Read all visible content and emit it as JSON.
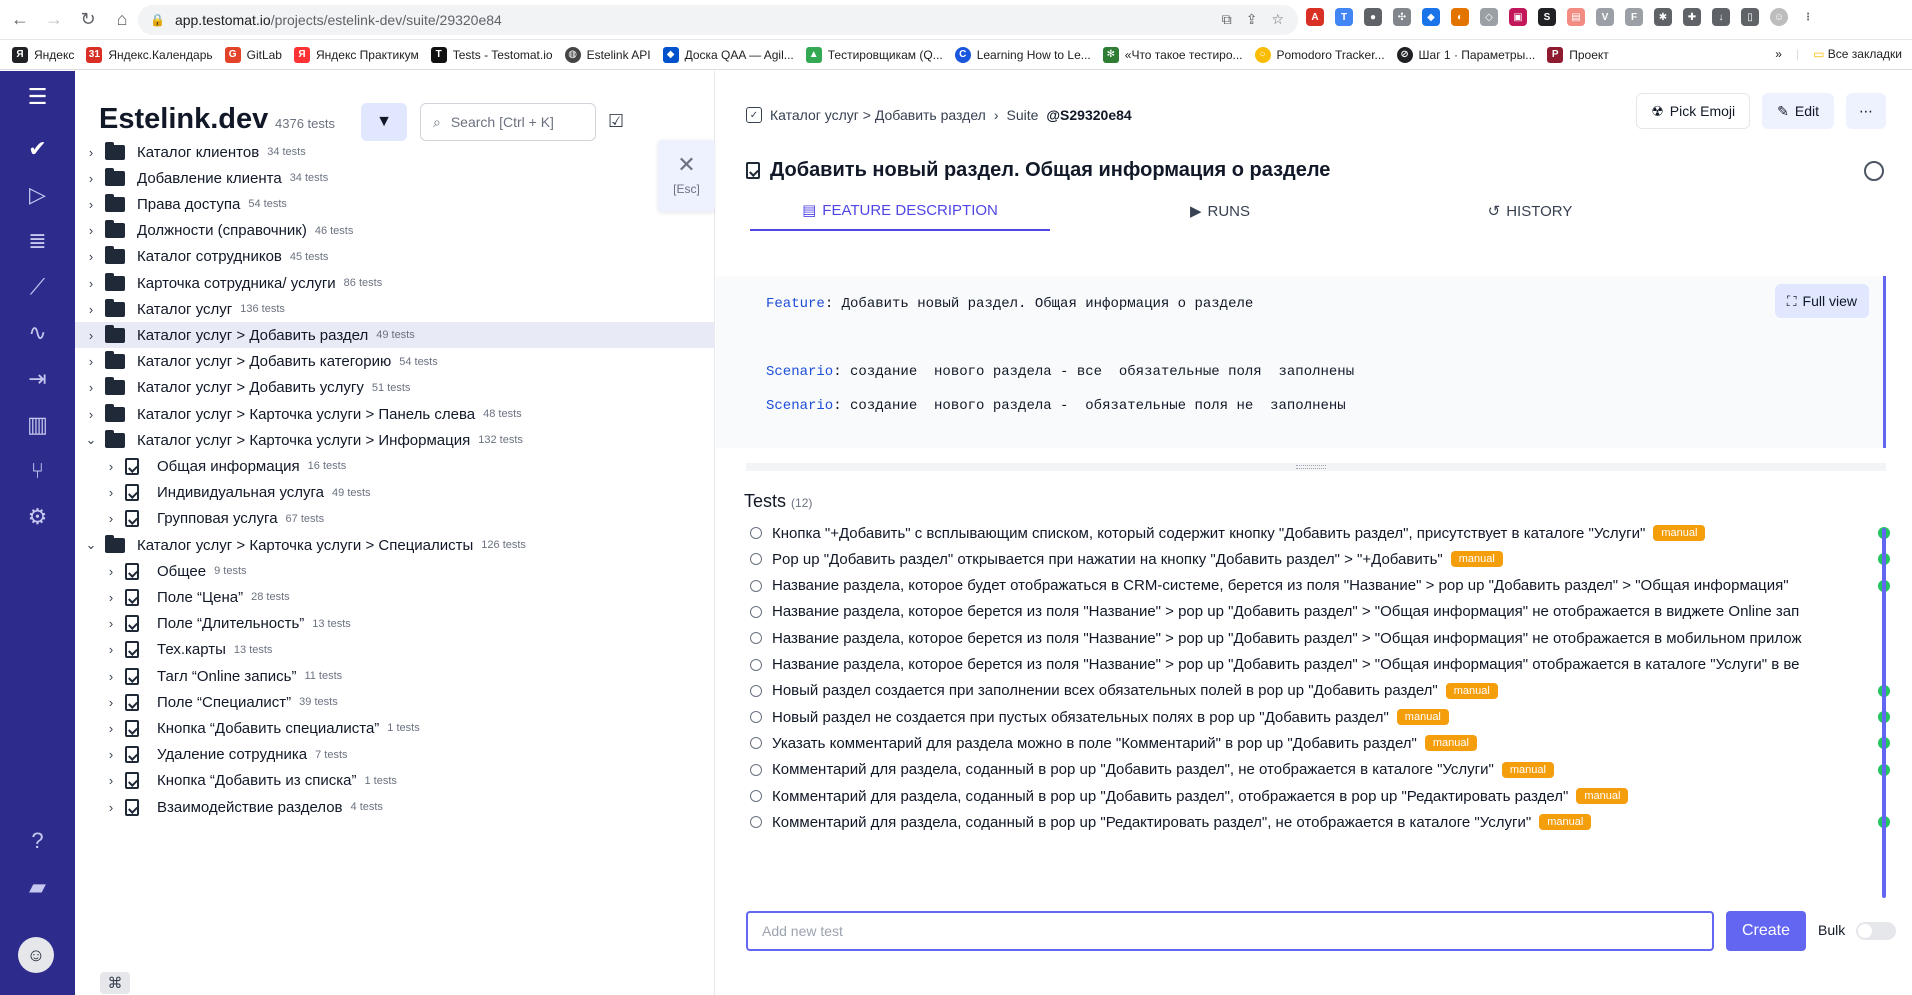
{
  "browser": {
    "url_host": "app.testomat.io",
    "url_path": "/projects/estelink-dev/suite/29320e84",
    "bookmarks": [
      "Яндекс",
      "Яндекс.Календарь",
      "GitLab",
      "Яндекс Практикум",
      "Tests - Testomat.io",
      "Estelink API",
      "Доска QAA — Agil...",
      "Тестировщикам (Q...",
      "Learning How to Le...",
      "«Что такое тестиро...",
      "Pomodoro Tracker...",
      "Шаг 1 · Параметры...",
      "Проект"
    ],
    "bookmarks_more": "»",
    "all_bookmarks": "Все закладки"
  },
  "project": {
    "title": "Estelink.dev",
    "count": "4376 tests",
    "search_placeholder": "Search [Ctrl + K]",
    "close_label": "[Esc]"
  },
  "tree": [
    {
      "label": "Каталог клиентов",
      "count": "34 tests",
      "type": "folder",
      "level": 0,
      "expanded": false
    },
    {
      "label": "Добавление клиента",
      "count": "34 tests",
      "type": "folder",
      "level": 0,
      "expanded": false
    },
    {
      "label": "Права доступа",
      "count": "54 tests",
      "type": "folder",
      "level": 0,
      "expanded": false
    },
    {
      "label": "Должности (справочник)",
      "count": "46 tests",
      "type": "folder",
      "level": 0,
      "expanded": false
    },
    {
      "label": "Каталог сотрудников",
      "count": "45 tests",
      "type": "folder",
      "level": 0,
      "expanded": false
    },
    {
      "label": "Карточка сотрудника/ услуги",
      "count": "86 tests",
      "type": "folder",
      "level": 0,
      "expanded": false
    },
    {
      "label": "Каталог услуг",
      "count": "136 tests",
      "type": "folder",
      "level": 0,
      "expanded": false
    },
    {
      "label": "Каталог услуг > Добавить раздел",
      "count": "49 tests",
      "type": "folder",
      "level": 0,
      "expanded": false,
      "selected": true
    },
    {
      "label": "Каталог услуг > Добавить категорию",
      "count": "54 tests",
      "type": "folder",
      "level": 0,
      "expanded": false
    },
    {
      "label": "Каталог услуг > Добавить услугу",
      "count": "51 tests",
      "type": "folder",
      "level": 0,
      "expanded": false
    },
    {
      "label": "Каталог услуг > Карточка услуги > Панель слева",
      "count": "48 tests",
      "type": "folder",
      "level": 0,
      "expanded": false
    },
    {
      "label": "Каталог услуг > Карточка услуги > Информация",
      "count": "132 tests",
      "type": "folder",
      "level": 0,
      "expanded": true
    },
    {
      "label": "Общая информация",
      "count": "16 tests",
      "type": "file",
      "level": 1,
      "expanded": false
    },
    {
      "label": "Индивидуальная услуга",
      "count": "49 tests",
      "type": "file",
      "level": 1,
      "expanded": false
    },
    {
      "label": "Групповая услуга",
      "count": "67 tests",
      "type": "file",
      "level": 1,
      "expanded": false
    },
    {
      "label": "Каталог услуг > Карточка услуги > Специалисты",
      "count": "126 tests",
      "type": "folder",
      "level": 0,
      "expanded": true
    },
    {
      "label": "Общее",
      "count": "9 tests",
      "type": "file",
      "level": 1,
      "expanded": false
    },
    {
      "label": "Поле “Цена”",
      "count": "28 tests",
      "type": "file",
      "level": 1,
      "expanded": false
    },
    {
      "label": "Поле “Длительность”",
      "count": "13 tests",
      "type": "file",
      "level": 1,
      "expanded": false
    },
    {
      "label": "Тех.карты",
      "count": "13 tests",
      "type": "file",
      "level": 1,
      "expanded": false
    },
    {
      "label": "Тагл “Online запись”",
      "count": "11 tests",
      "type": "file",
      "level": 1,
      "expanded": false
    },
    {
      "label": "Поле “Специалист”",
      "count": "39 tests",
      "type": "file",
      "level": 1,
      "expanded": false
    },
    {
      "label": "Кнопка “Добавить специалиста”",
      "count": "1 tests",
      "type": "file",
      "level": 1,
      "expanded": false
    },
    {
      "label": "Удаление сотрудника",
      "count": "7 tests",
      "type": "file",
      "level": 1,
      "expanded": false
    },
    {
      "label": "Кнопка “Добавить из списка”",
      "count": "1 tests",
      "type": "file",
      "level": 1,
      "expanded": false
    },
    {
      "label": "Взаимодействие разделов",
      "count": "4 tests",
      "type": "file",
      "level": 1,
      "expanded": false
    }
  ],
  "detail": {
    "breadcrumb": "Каталог услуг > Добавить раздел",
    "suite_label": "Suite",
    "suite_id": "@S29320e84",
    "pick_emoji": "Pick Emoji",
    "edit": "Edit",
    "more": "⋯",
    "title": "Добавить новый раздел. Общая информация о разделе",
    "tabs": [
      "FEATURE DESCRIPTION",
      "RUNS",
      "HISTORY"
    ],
    "full_view": "Full view",
    "feature_kw": "Feature",
    "feature_text": ": Добавить новый раздел. Общая информация о разделе",
    "scenario_kw": "Scenario",
    "scenario1": ": создание  нового раздела - все  обязательные поля  заполнены",
    "scenario2": ": создание  нового раздела -  обязательные поля не  заполнены",
    "tests_label": "Tests",
    "tests_count": "(12)",
    "add_placeholder": "Add new test",
    "create": "Create",
    "bulk": "Bulk"
  },
  "tests": [
    {
      "title": "Кнопка \"+Добавить\" с всплывающим списком, который содержит кнопку \"Добавить раздел\", присутствует в каталоге \"Услуги\"",
      "badge": "manual",
      "ok": true
    },
    {
      "title": "Pop up \"Добавить раздел\" открывается при нажатии на кнопку \"Добавить раздел\" > \"+Добавить\"",
      "badge": "manual",
      "ok": true
    },
    {
      "title": "Название раздела, которое будет отображаться в CRM-системе, берется из поля \"Название\" > pop up \"Добавить раздел\" > \"Общая информация\"",
      "badge": "",
      "ok": true
    },
    {
      "title": "Название раздела, которое берется из поля \"Название\" > pop up \"Добавить раздел\" > \"Общая информация\" не отображается в виджете Online зап",
      "badge": "",
      "ok": false
    },
    {
      "title": "Название раздела, которое берется из поля \"Название\" > pop up \"Добавить раздел\" > \"Общая информация\" не отображается в мобильном прилож",
      "badge": "",
      "ok": false
    },
    {
      "title": "Название раздела, которое берется из поля \"Название\" > pop up \"Добавить раздел\" > \"Общая информация\" отображается в каталоге \"Услуги\" в ве",
      "badge": "",
      "ok": false
    },
    {
      "title": "Новый раздел создается при заполнении всех обязательных полей в pop up \"Добавить раздел\"",
      "badge": "manual",
      "ok": true
    },
    {
      "title": "Новый раздел не создается при пустых обязательных полях в pop up \"Добавить раздел\"",
      "badge": "manual",
      "ok": true
    },
    {
      "title": "Указать комментарий для раздела можно в поле \"Комментарий\" в pop up \"Добавить раздел\"",
      "badge": "manual",
      "ok": true
    },
    {
      "title": "Комментарий для раздела, соданный в pop up \"Добавить раздел\", не отображается в каталоге \"Услуги\"",
      "badge": "manual",
      "ok": true
    },
    {
      "title": "Комментарий для раздела, соданный в pop up \"Добавить раздел\", отображается в pop up \"Редактировать раздел\"",
      "badge": "manual",
      "ok": false
    },
    {
      "title": "Комментарий для раздела, соданный в pop up \"Редактировать раздел\", не отображается в каталоге \"Услуги\"",
      "badge": "manual",
      "ok": true
    }
  ],
  "colors": {
    "rail": "#2d2c8d",
    "accent": "#6366f1",
    "badge": "#f59e0b",
    "ok": "#22c55e"
  }
}
